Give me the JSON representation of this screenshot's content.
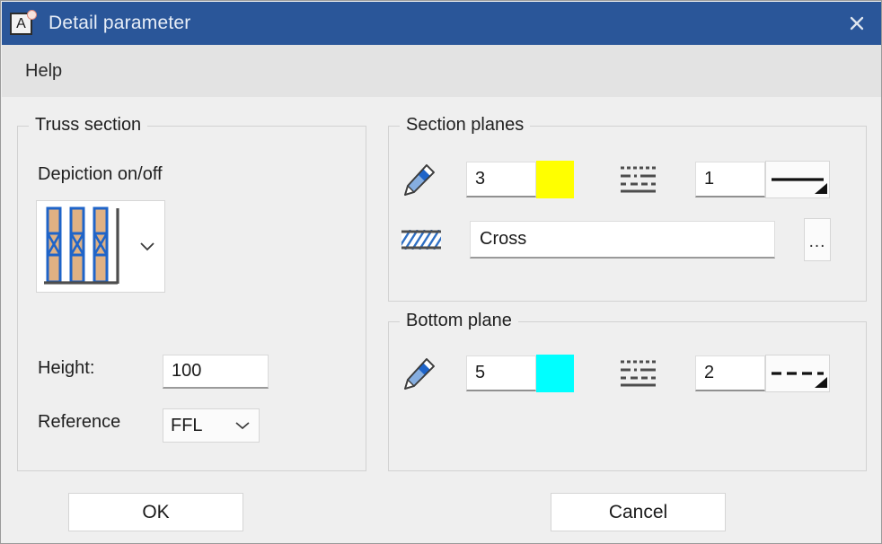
{
  "window": {
    "title": "Detail parameter",
    "icon_name": "app-sheet-icon",
    "icon_letter": "A",
    "close_label": "×",
    "titlebar_color": "#2a5699"
  },
  "menubar": {
    "items": [
      {
        "label": "Help"
      }
    ]
  },
  "truss_section": {
    "group_title": "Truss section",
    "depiction_label": "Depiction on/off",
    "depiction_preview_name": "truss-columns-preview",
    "height_label": "Height:",
    "height_value": "100",
    "reference_label": "Reference",
    "reference_value": "FFL"
  },
  "section_planes": {
    "group_title": "Section planes",
    "pen_icon": "pencil-icon",
    "pen_value": "3",
    "color_value": "#ffff00",
    "linetype_icon": "line-types-icon",
    "linetype_value": "1",
    "linestyle_preview": "solid",
    "hatch_icon": "hatch-pattern-icon",
    "hatch_name": "Cross",
    "browse_label": "..."
  },
  "bottom_plane": {
    "group_title": "Bottom plane",
    "pen_icon": "pencil-icon",
    "pen_value": "5",
    "color_value": "#00ffff",
    "linetype_icon": "line-types-icon",
    "linetype_value": "2",
    "linestyle_preview": "dashed"
  },
  "footer": {
    "ok_label": "OK",
    "cancel_label": "Cancel"
  }
}
